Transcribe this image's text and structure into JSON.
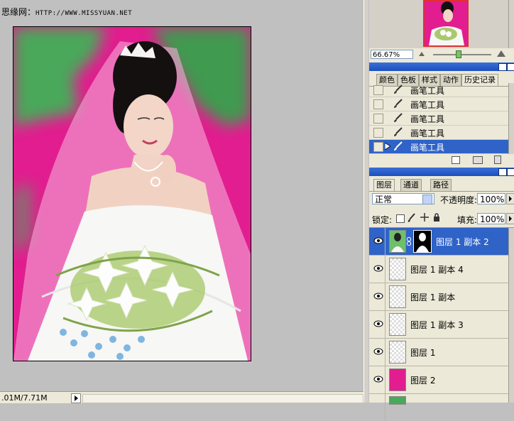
{
  "watermark": {
    "site_name": "思缘网：",
    "url": "HTTP://WWW.MISSYUAN.NET"
  },
  "status_bar": {
    "doc_size": ".01M/7.71M"
  },
  "navigator": {
    "zoom": "66.67%"
  },
  "history_panel": {
    "tabs": [
      "颜色",
      "色板",
      "样式",
      "动作",
      "历史记录"
    ],
    "active_tab": "历史记录",
    "items": [
      {
        "label": "画笔工具",
        "selected": false
      },
      {
        "label": "画笔工具",
        "selected": false
      },
      {
        "label": "画笔工具",
        "selected": false
      },
      {
        "label": "画笔工具",
        "selected": false
      },
      {
        "label": "画笔工具",
        "selected": true
      }
    ]
  },
  "layers_panel": {
    "tabs": [
      "图层",
      "通道",
      "路径"
    ],
    "active_tab": "图层",
    "blend_mode": "正常",
    "opacity_label": "不透明度:",
    "opacity_value": "100%",
    "lock_label": "锁定:",
    "fill_label": "填充:",
    "fill_value": "100%",
    "layers": [
      {
        "name": "图层 1 副本 2",
        "selected": true,
        "thumb": "photo-with-mask"
      },
      {
        "name": "图层 1 副本 4",
        "selected": false,
        "thumb": "transparent"
      },
      {
        "name": "图层 1 副本",
        "selected": false,
        "thumb": "transparent"
      },
      {
        "name": "图层 1 副本 3",
        "selected": false,
        "thumb": "transparent"
      },
      {
        "name": "图层 1",
        "selected": false,
        "thumb": "transparent"
      },
      {
        "name": "图层 2",
        "selected": false,
        "thumb": "magenta"
      }
    ]
  },
  "colors": {
    "title_blue": "#1c4fbf",
    "selection_blue": "#2f63c8",
    "magenta": "#e21d8f",
    "panel_bg": "#ece9d8"
  }
}
